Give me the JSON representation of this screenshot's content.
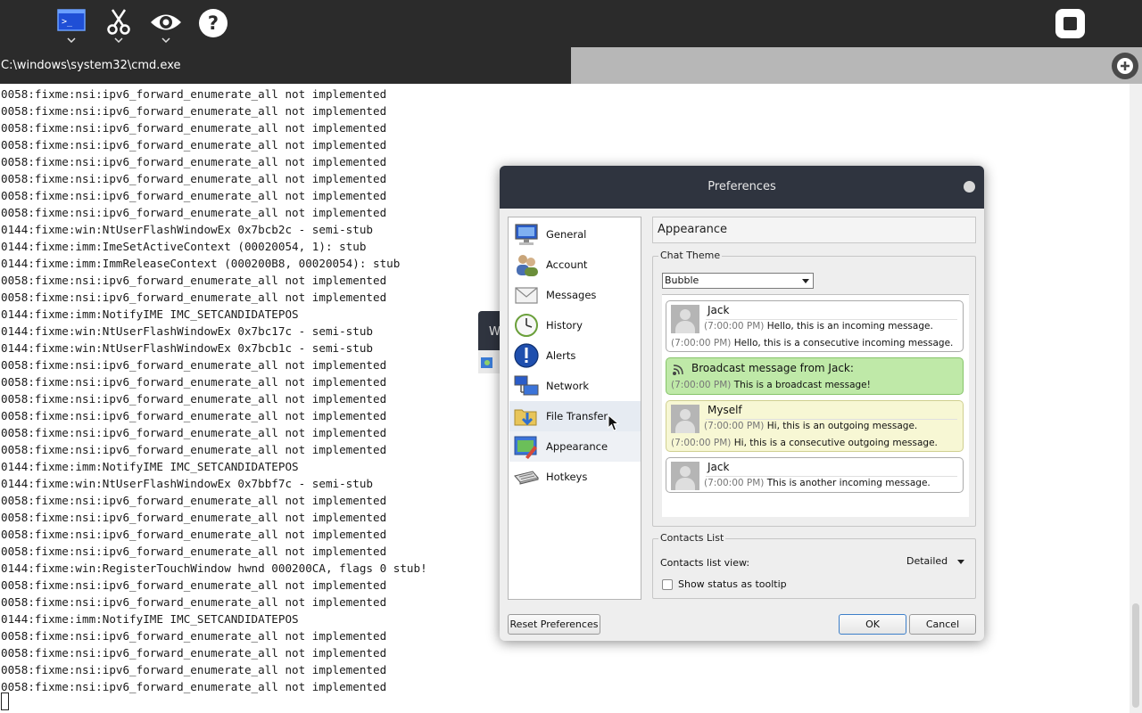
{
  "toolbar": {
    "buttons": [
      {
        "icon": "terminal-icon",
        "has_menu": true
      },
      {
        "icon": "scissors-icon",
        "has_menu": true
      },
      {
        "icon": "eye-icon",
        "has_menu": true
      },
      {
        "icon": "help-icon",
        "has_menu": false
      }
    ],
    "stop_icon": "stop-icon"
  },
  "tabs": {
    "active_title": "C:\\windows\\system32\\cmd.exe",
    "new_tab_icon": "plus-icon"
  },
  "console": {
    "lines": [
      "0058:fixme:nsi:ipv6_forward_enumerate_all not implemented",
      "0058:fixme:nsi:ipv6_forward_enumerate_all not implemented",
      "0058:fixme:nsi:ipv6_forward_enumerate_all not implemented",
      "0058:fixme:nsi:ipv6_forward_enumerate_all not implemented",
      "0058:fixme:nsi:ipv6_forward_enumerate_all not implemented",
      "0058:fixme:nsi:ipv6_forward_enumerate_all not implemented",
      "0058:fixme:nsi:ipv6_forward_enumerate_all not implemented",
      "0058:fixme:nsi:ipv6_forward_enumerate_all not implemented",
      "0144:fixme:win:NtUserFlashWindowEx 0x7bcb2c - semi-stub",
      "0144:fixme:imm:ImeSetActiveContext (00020054, 1): stub",
      "0144:fixme:imm:ImmReleaseContext (000200B8, 00020054): stub",
      "0058:fixme:nsi:ipv6_forward_enumerate_all not implemented",
      "0058:fixme:nsi:ipv6_forward_enumerate_all not implemented",
      "0144:fixme:imm:NotifyIME IMC_SETCANDIDATEPOS",
      "0144:fixme:win:NtUserFlashWindowEx 0x7bc17c - semi-stub",
      "0144:fixme:win:NtUserFlashWindowEx 0x7bcb1c - semi-stub",
      "0058:fixme:nsi:ipv6_forward_enumerate_all not implemented",
      "0058:fixme:nsi:ipv6_forward_enumerate_all not implemented",
      "0058:fixme:nsi:ipv6_forward_enumerate_all not implemented",
      "0058:fixme:nsi:ipv6_forward_enumerate_all not implemented",
      "0058:fixme:nsi:ipv6_forward_enumerate_all not implemented",
      "0058:fixme:nsi:ipv6_forward_enumerate_all not implemented",
      "0144:fixme:imm:NotifyIME IMC_SETCANDIDATEPOS",
      "0144:fixme:win:NtUserFlashWindowEx 0x7bbf7c - semi-stub",
      "0058:fixme:nsi:ipv6_forward_enumerate_all not implemented",
      "0058:fixme:nsi:ipv6_forward_enumerate_all not implemented",
      "0058:fixme:nsi:ipv6_forward_enumerate_all not implemented",
      "0058:fixme:nsi:ipv6_forward_enumerate_all not implemented",
      "0144:fixme:win:RegisterTouchWindow hwnd 000200CA, flags 0 stub!",
      "0058:fixme:nsi:ipv6_forward_enumerate_all not implemented",
      "0058:fixme:nsi:ipv6_forward_enumerate_all not implemented",
      "0144:fixme:imm:NotifyIME IMC_SETCANDIDATEPOS",
      "0058:fixme:nsi:ipv6_forward_enumerate_all not implemented",
      "0058:fixme:nsi:ipv6_forward_enumerate_all not implemented",
      "0058:fixme:nsi:ipv6_forward_enumerate_all not implemented",
      "0058:fixme:nsi:ipv6_forward_enumerate_all not implemented"
    ]
  },
  "background_window": {
    "letter": "W"
  },
  "dialog": {
    "title": "Preferences",
    "close_icon": "close-icon",
    "nav": [
      {
        "label": "General",
        "icon": "monitor-icon"
      },
      {
        "label": "Account",
        "icon": "users-icon"
      },
      {
        "label": "Messages",
        "icon": "envelope-icon"
      },
      {
        "label": "History",
        "icon": "clock-icon"
      },
      {
        "label": "Alerts",
        "icon": "alert-icon"
      },
      {
        "label": "Network",
        "icon": "network-icon"
      },
      {
        "label": "File Transfer",
        "icon": "folder-download-icon"
      },
      {
        "label": "Appearance",
        "icon": "appearance-icon"
      },
      {
        "label": "Hotkeys",
        "icon": "keyboard-icon"
      }
    ],
    "selected_nav": "Appearance",
    "hovered_nav": "File Transfer",
    "content_title": "Appearance",
    "chat_theme": {
      "group_title": "Chat Theme",
      "selected": "Bubble",
      "preview": [
        {
          "kind": "incoming",
          "name": "Jack",
          "lines": [
            {
              "time": "(7:00:00 PM)",
              "text": "Hello, this is an incoming message."
            },
            {
              "time": "(7:00:00 PM)",
              "text": "Hello, this is a consecutive incoming message."
            }
          ]
        },
        {
          "kind": "broadcast",
          "title": "Broadcast message from Jack:",
          "lines": [
            {
              "time": "(7:00:00 PM)",
              "text": "This is a broadcast message!"
            }
          ]
        },
        {
          "kind": "outgoing",
          "name": "Myself",
          "lines": [
            {
              "time": "(7:00:00 PM)",
              "text": "Hi, this is an outgoing message."
            },
            {
              "time": "(7:00:00 PM)",
              "text": "Hi, this is a consecutive outgoing message."
            }
          ]
        },
        {
          "kind": "incoming",
          "name": "Jack",
          "lines": [
            {
              "time": "(7:00:00 PM)",
              "text": "This is another incoming message."
            }
          ]
        }
      ]
    },
    "contacts_list": {
      "group_title": "Contacts List",
      "view_label": "Contacts list view:",
      "view_value": "Detailed",
      "tooltip_label": "Show status as tooltip",
      "tooltip_checked": false
    },
    "buttons": {
      "reset": "Reset Preferences",
      "ok": "OK",
      "cancel": "Cancel"
    }
  }
}
